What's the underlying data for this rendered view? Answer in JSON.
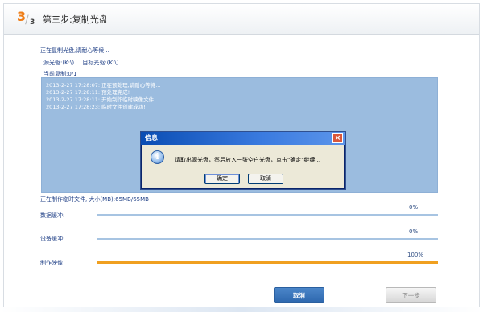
{
  "header": {
    "step_current": "3",
    "step_total": "3",
    "title": "第三步:复制光盘"
  },
  "status": {
    "main": "正在复制光盘,请耐心等候...",
    "source_drive": "源光驱:(K:\\)",
    "target_drive": "目标光驱:(K:\\)",
    "current_copy": "当前复制:0/1"
  },
  "log": [
    "2013-2-27 17:28:07: 正在预处理,请耐心等待...",
    "2013-2-27 17:28:11: 预处理完成!",
    "2013-2-27 17:28:11: 开始制作临时映像文件",
    "2013-2-27 17:28:23: 临时文件创建成功!"
  ],
  "temp_file": "正在制作临时文件, 大小(MB):65MB/65MB",
  "progress": [
    {
      "label": "数据缓冲:",
      "percent_text": "0%",
      "value": 0
    },
    {
      "label": "设备缓冲:",
      "percent_text": "0%",
      "value": 0
    },
    {
      "label": "制作映像",
      "percent_text": "100%",
      "value": 100
    }
  ],
  "buttons": {
    "cancel": "取消",
    "next": "下一步"
  },
  "dialog": {
    "title": "信息",
    "close": "×",
    "icon": "info-icon",
    "message": "请取出源光盘，然后放入一张空白光盘，点击\"确定\"继续...",
    "ok": "确定",
    "cancel": "取消"
  },
  "colors": {
    "accent": "#ef7d16",
    "progress_fill": "#f0a020",
    "progress_track": "#a7c4e2",
    "log_bg": "#9bbcdf"
  }
}
